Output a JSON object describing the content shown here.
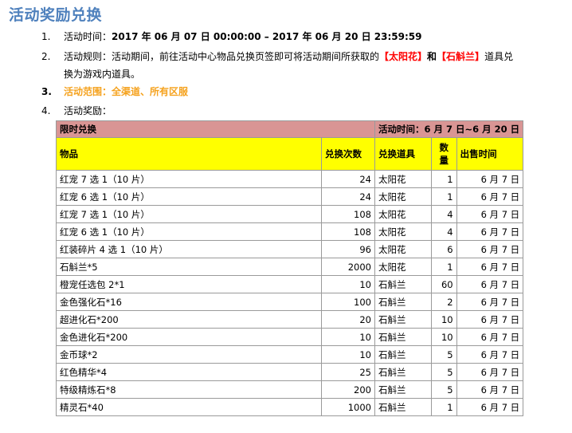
{
  "title": "活动奖励兑换",
  "items": [
    {
      "num": "1.",
      "label": "活动时间：",
      "value": "2017 年 06 月 07 日  00:00:00  –  2017 年 06 月 20 日  23:59:59"
    },
    {
      "num": "2.",
      "prefix": "活动规则：活动期间，前往活动中心物品兑换页签即可将活动期间所获取的",
      "hl1": "【太阳花】",
      "mid": "和",
      "hl2": "【石斛兰】",
      "suffix": "道具兑",
      "line2": "换为游戏内道具。"
    },
    {
      "num": "3.",
      "text": "活动范围：全渠道、所有区服"
    },
    {
      "num": "4.",
      "text": "活动奖励："
    }
  ],
  "table": {
    "section_label": "限时兑换",
    "period_label": "活动时间：6 月 7 日~6 月 20 日",
    "headers": {
      "item": "物品",
      "count": "兑换次数",
      "tool": "兑换道具",
      "qty": "数\n量",
      "time": "出售时间"
    },
    "rows": [
      {
        "item": "红宠 7 选 1（10 片）",
        "count": "24",
        "tool": "太阳花",
        "qty": "1",
        "time": "6 月 7 日"
      },
      {
        "item": "红宠 6 选 1（10 片）",
        "count": "24",
        "tool": "太阳花",
        "qty": "1",
        "time": "6 月 7 日"
      },
      {
        "item": "红宠 7 选 1（10 片）",
        "count": "108",
        "tool": "太阳花",
        "qty": "4",
        "time": "6 月 7 日"
      },
      {
        "item": "红宠 6 选 1（10 片）",
        "count": "108",
        "tool": "太阳花",
        "qty": "4",
        "time": "6 月 7 日"
      },
      {
        "item": "红装碎片 4 选 1（10 片）",
        "count": "96",
        "tool": "太阳花",
        "qty": "6",
        "time": "6 月 7 日"
      },
      {
        "item": "石斛兰*5",
        "count": "2000",
        "tool": "太阳花",
        "qty": "1",
        "time": "6 月 7 日"
      },
      {
        "item": "橙宠任选包 2*1",
        "count": "10",
        "tool": "石斛兰",
        "qty": "60",
        "time": "6 月 7 日"
      },
      {
        "item": "金色强化石*16",
        "count": "100",
        "tool": "石斛兰",
        "qty": "2",
        "time": "6 月 7 日"
      },
      {
        "item": "超进化石*200",
        "count": "20",
        "tool": "石斛兰",
        "qty": "10",
        "time": "6 月 7 日"
      },
      {
        "item": "金色进化石*200",
        "count": "10",
        "tool": "石斛兰",
        "qty": "10",
        "time": "6 月 7 日"
      },
      {
        "item": "金币球*2",
        "count": "10",
        "tool": "石斛兰",
        "qty": "5",
        "time": "6 月 7 日"
      },
      {
        "item": "红色精华*4",
        "count": "25",
        "tool": "石斛兰",
        "qty": "5",
        "time": "6 月 7 日"
      },
      {
        "item": "特级精炼石*8",
        "count": "200",
        "tool": "石斛兰",
        "qty": "5",
        "time": "6 月 7 日"
      },
      {
        "item": "精灵石*40",
        "count": "1000",
        "tool": "石斛兰",
        "qty": "1",
        "time": "6 月 7 日"
      }
    ]
  }
}
